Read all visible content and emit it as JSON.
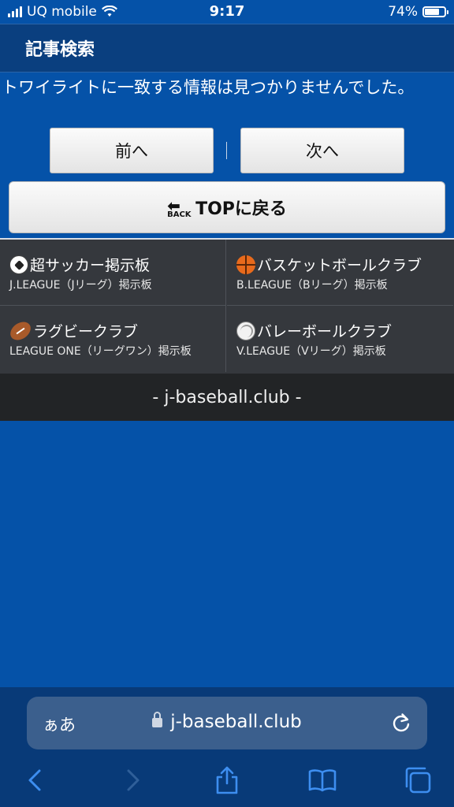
{
  "status_bar": {
    "carrier": "UQ mobile",
    "time": "9:17",
    "battery_percent": "74%",
    "battery_level": 0.74
  },
  "page": {
    "title": "記事検索",
    "message": "トワイライトに一致する情報は見つかりませんでした。"
  },
  "nav": {
    "prev_label": "前へ",
    "next_label": "次へ",
    "top_label": "TOPに戻る",
    "back_icon_text": "BACK"
  },
  "boards": [
    {
      "title": "超サッカー掲示板",
      "subtitle": "J.LEAGUE（Jリーグ）掲示板",
      "icon": "soccer-ball-icon"
    },
    {
      "title": "バスケットボールクラブ",
      "subtitle": "B.LEAGUE（Bリーグ）掲示板",
      "icon": "basketball-icon"
    },
    {
      "title": "ラグビークラブ",
      "subtitle": "LEAGUE ONE（リーグワン）掲示板",
      "icon": "rugby-ball-icon"
    },
    {
      "title": "バレーボールクラブ",
      "subtitle": "V.LEAGUE（Vリーグ）掲示板",
      "icon": "volleyball-icon"
    }
  ],
  "footer": {
    "site_name": "- j-baseball.club -"
  },
  "browser": {
    "text_size_label": "ぁあ",
    "url": "j-baseball.club"
  },
  "colors": {
    "page_background": "#0552a8",
    "title_bar": "#0a3f7f",
    "grid_background": "#35383d",
    "footer_background": "#222426",
    "toolbar_icon": "#3d8ef0"
  }
}
